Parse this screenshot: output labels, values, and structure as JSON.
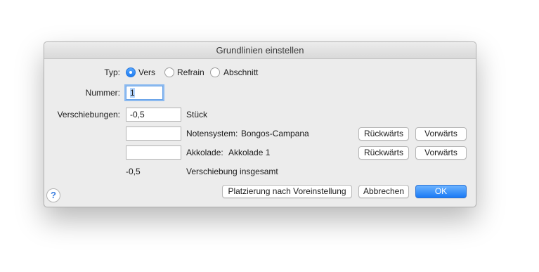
{
  "window": {
    "title": "Grundlinien einstellen"
  },
  "typ": {
    "label": "Typ:",
    "options": [
      {
        "label": "Vers",
        "selected": true
      },
      {
        "label": "Refrain",
        "selected": false
      },
      {
        "label": "Abschnitt",
        "selected": false
      }
    ]
  },
  "nummer": {
    "label": "Nummer:",
    "value": "1"
  },
  "verschiebungen": {
    "label": "Verschiebungen:",
    "stueck": {
      "value": "-0,5",
      "unit": "Stück"
    },
    "notensystem": {
      "value": "",
      "label": "Notensystem:",
      "name": "Bongos-Campana",
      "back": "Rückwärts",
      "forward": "Vorwärts"
    },
    "akkolade": {
      "value": "",
      "label": "Akkolade:",
      "name": "Akkolade 1",
      "back": "Rückwärts",
      "forward": "Vorwärts"
    },
    "total": {
      "value": "-0,5",
      "label": "Verschiebung insgesamt"
    }
  },
  "footer": {
    "help": "?",
    "default_button": "Platzierung nach Voreinstellung",
    "cancel_button": "Abbrechen",
    "ok_button": "OK"
  },
  "colors": {
    "accent": "#1e7cf2",
    "dialog_bg": "#ececec",
    "help": "#3c7fe0"
  }
}
